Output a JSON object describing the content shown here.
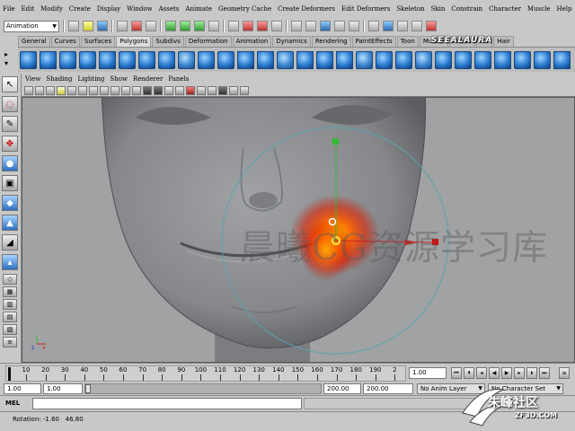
{
  "menubar": {
    "items": [
      "File",
      "Edit",
      "Modify",
      "Create",
      "Display",
      "Window",
      "Assets",
      "Animate",
      "Geometry Cache",
      "Create Deformers",
      "Edit Deformers",
      "Skeleton",
      "Skin",
      "Constrain",
      "Character",
      "Muscle",
      "Help"
    ]
  },
  "statusline": {
    "menuset": "Animation"
  },
  "shelf": {
    "tabs": [
      "General",
      "Curves",
      "Surfaces",
      "Polygons",
      "Subdivs",
      "Deformation",
      "Animation",
      "Dynamics",
      "Rendering",
      "PaintEffects",
      "Toon",
      "Muscle",
      "Fluids",
      "Fur",
      "Hair"
    ],
    "active_tab": "Polygons"
  },
  "panel": {
    "menu": [
      "View",
      "Shading",
      "Lighting",
      "Show",
      "Renderer",
      "Panels"
    ]
  },
  "viewport": {
    "watermark": "晨曦CG资源学习库",
    "axis_x": "x",
    "axis_z": "z",
    "background": "#a0a2a4",
    "mesh_color": "#8e9093",
    "manipulator_color": "#5aa4b0",
    "paint_color": "#ff5a00"
  },
  "timeslider": {
    "ticks": [
      "10",
      "20",
      "30",
      "40",
      "50",
      "60",
      "70",
      "80",
      "90",
      "100",
      "110",
      "120",
      "130",
      "140",
      "150",
      "160",
      "170",
      "180",
      "190",
      "2"
    ],
    "current_frame": "1.00"
  },
  "rangeslider": {
    "start_time": "1.00",
    "range_start": "1.00",
    "range_end": "200.00",
    "end_time": "200.00",
    "anim_layer": "No Anim Layer",
    "character_set": "No Character Set"
  },
  "cmdline": {
    "label": "MEL"
  },
  "helpline": {
    "text": "Rotation: -1.60   46.80"
  },
  "logos": {
    "top": "SEEALAURA",
    "bottom_cn": "朱峰社区",
    "bottom_en": "ZF3D.COM"
  }
}
